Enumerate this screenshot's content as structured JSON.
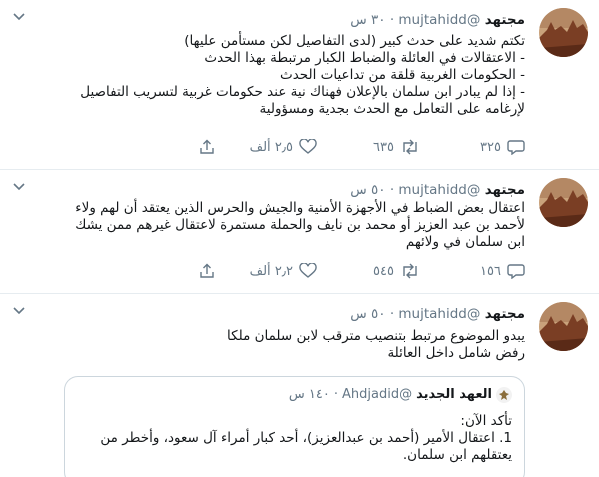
{
  "tweets": [
    {
      "name": "مجتهد",
      "handle": "@mujtahidd",
      "dot": "·",
      "time": "٣٠ س",
      "lines": [
        "تكتم شديد على حدث كبير  (لدى التفاصيل لكن مستأمن عليها)",
        "- الاعتقالات في العائلة والضباط الكبار مرتبطة بهذا الحدث",
        "- الحكومات الغربية قلقة من تداعيات الحدث",
        "- إذا لم يبادر ابن سلمان بالإعلان فهناك نية عند حكومات غربية لتسريب التفاصيل",
        "لإرغامه على التعامل مع الحدث بجدية ومسؤولية"
      ],
      "replies": "٣٢٥",
      "retweets": "٦٣٥",
      "likes": "٢٫٥ ألف"
    },
    {
      "name": "مجتهد",
      "handle": "@mujtahidd",
      "dot": "·",
      "time": "٥٠ س",
      "lines": [
        "اعتقال بعض الضباط في الأجهزة الأمنية والجيش والحرس الذين يعتقد أن لهم ولاء",
        "لأحمد بن عبد العزيز أو محمد بن نايف والحملة مستمرة لاعتقال غيرهم ممن يشك",
        "ابن سلمان في ولائهم"
      ],
      "replies": "١٥٦",
      "retweets": "٥٤٥",
      "likes": "٢٫٢ ألف"
    },
    {
      "name": "مجتهد",
      "handle": "@mujtahidd",
      "dot": "·",
      "time": "٥٠ س",
      "lines": [
        "يبدو الموضوع مرتبط بتنصيب مترقب لابن سلمان ملكا",
        "رفض شامل داخل العائلة"
      ],
      "quote": {
        "name": "العهد الجديد",
        "handle": "@Ahdjadid",
        "dot": "·",
        "time": "١٤٠ س",
        "lines": [
          "تأكد الآن:",
          "1. اعتقال الأمير (أحمد بن عبدالعزيز)، أحد كبار أمراء آل سعود، وأخطر من",
          "يعتقلهم ابن سلمان."
        ]
      }
    }
  ]
}
